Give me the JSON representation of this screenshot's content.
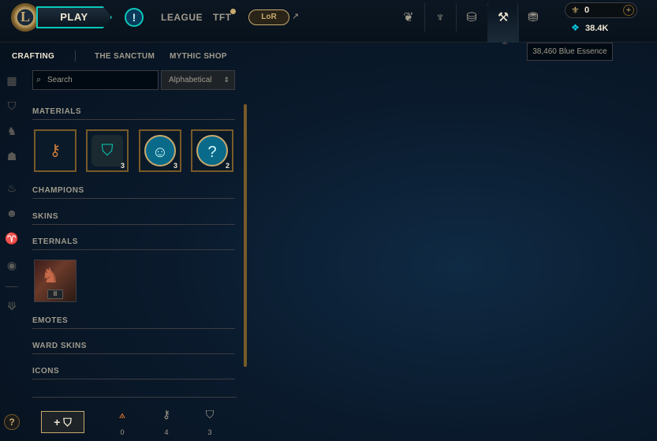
{
  "topbar": {
    "logo_letter": "L",
    "play_label": "PLAY",
    "nav": [
      "LEAGUE",
      "TFT"
    ],
    "lor_label": "LoR",
    "rp_value": "0",
    "be_value": "38.4K",
    "tooltip": "38,460 Blue Essence"
  },
  "subnav": {
    "items": [
      "CRAFTING",
      "THE SANCTUM",
      "MYTHIC SHOP"
    ]
  },
  "search": {
    "placeholder": "Search"
  },
  "sort": {
    "selected": "Alphabetical"
  },
  "sections": [
    "MATERIALS",
    "CHAMPIONS",
    "SKINS",
    "ETERNALS",
    "EMOTES",
    "WARD SKINS",
    "ICONS"
  ],
  "materials": [
    {
      "icon": "key-fragment-icon",
      "count": ""
    },
    {
      "icon": "chest-icon",
      "count": "3"
    },
    {
      "icon": "emote-token-icon",
      "count": "3"
    },
    {
      "icon": "mystery-orb-icon",
      "count": "2"
    }
  ],
  "eternals": [
    {
      "badge": "II"
    }
  ],
  "bottom": {
    "add_chest_label": "+ ⛉",
    "resources": [
      {
        "icon": "orange-essence-icon",
        "count": "0",
        "color": "#e87a2a"
      },
      {
        "icon": "key-icon",
        "count": "4",
        "color": "#a09b8c"
      },
      {
        "icon": "chest-icon",
        "count": "3",
        "color": "#a09b8c"
      }
    ]
  },
  "help_label": "?",
  "colors": {
    "gold": "#c8aa6e",
    "teal": "#0ac8b9",
    "blue_essence": "#0acbe6"
  }
}
